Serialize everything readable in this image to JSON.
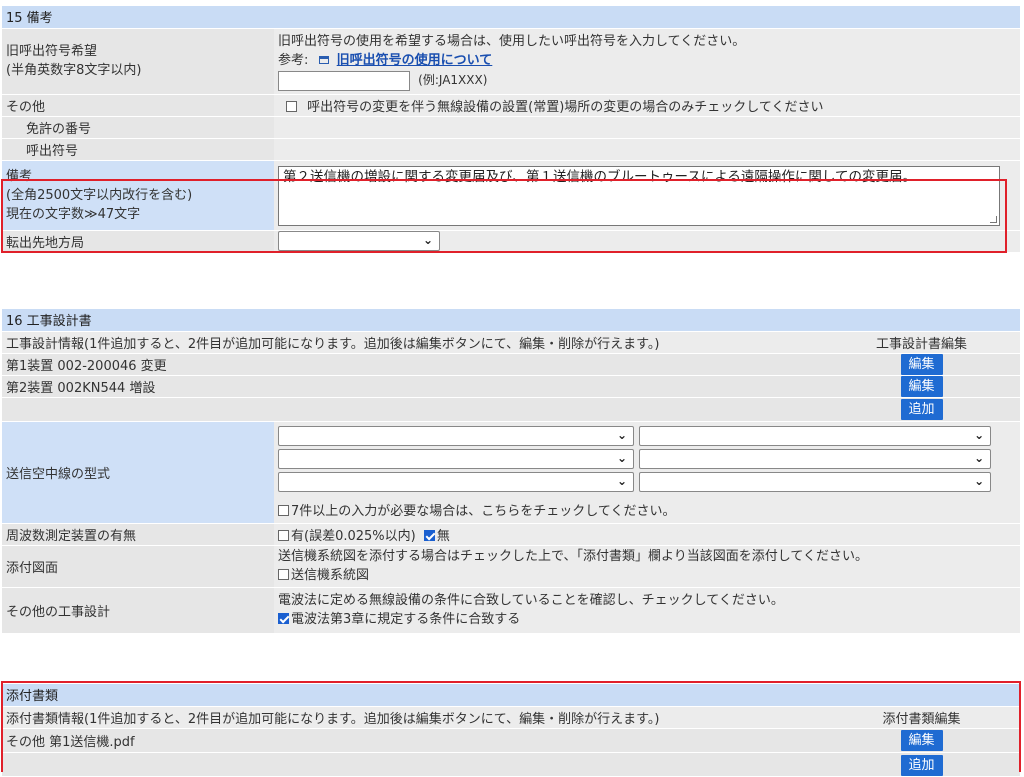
{
  "section15": {
    "header": "15 備考",
    "old_callsign": {
      "label_line1": "旧呼出符号希望",
      "label_line2": "(半角英数字8文字以内)",
      "instruction": "旧呼出符号の使用を希望する場合は、使用したい呼出符号を入力してください。",
      "ref_prefix": "参考:",
      "ref_link": "旧呼出符号の使用について",
      "input_value": "",
      "example": "(例:JA1XXX)"
    },
    "other": {
      "label": "その他",
      "checkbox_label": "呼出符号の変更を伴う無線設備の設置(常置)場所の変更の場合のみチェックしてください",
      "checked": false
    },
    "license_number_label": "免許の番号",
    "callsign_label": "呼出符号",
    "remarks": {
      "label_line1": "備考",
      "label_line2": "(全角2500文字以内改行を含む)",
      "label_line3": "現在の文字数≫47文字",
      "text": "第２送信機の増設に関する変更届及び、第１送信機のブルートゥースによる遠隔操作に関しての変更届。"
    },
    "transfer_bureau": {
      "label": "転出先地方局",
      "selected": ""
    }
  },
  "section16": {
    "header": "16 工事設計書",
    "info_text": "工事設計情報(1件追加すると、2件目が追加可能になります。追加後は編集ボタンにて、編集・削除が行えます。)",
    "edit_column_header": "工事設計書編集",
    "devices": [
      {
        "text": "第1装置 002-200046 変更",
        "button": "編集"
      },
      {
        "text": "第2装置 002KN544 増設",
        "button": "編集"
      }
    ],
    "add_button": "追加",
    "antenna": {
      "label": "送信空中線の型式",
      "checkbox_label": "7件以上の入力が必要な場合は、こちらをチェックしてください。",
      "checked": false
    },
    "freq_device": {
      "label": "周波数測定装置の有無",
      "option_yes": "有(誤差0.025%以内)",
      "yes_checked": false,
      "option_no": "無",
      "no_checked": true
    },
    "attached_drawing": {
      "label": "添付図面",
      "instruction": "送信機系統図を添付する場合はチェックした上で、「添付書類」欄より当該図面を添付してください。",
      "checkbox_label": "送信機系統図",
      "checked": false
    },
    "other_design": {
      "label": "その他の工事設計",
      "instruction": "電波法に定める無線設備の条件に合致していることを確認し、チェックしてください。",
      "checkbox_label": "電波法第3章に規定する条件に合致する",
      "checked": true
    }
  },
  "attachments": {
    "header": "添付書類",
    "info_text": "添付書類情報(1件追加すると、2件目が追加可能になります。追加後は編集ボタンにて、編集・削除が行えます。)",
    "edit_column_header": "添付書類編集",
    "files": [
      {
        "text": "その他 第1送信機.pdf",
        "button": "編集"
      }
    ],
    "add_button": "追加"
  },
  "colors": {
    "header_bg": "#c9dcf5",
    "button_bg": "#1f6bd2",
    "highlight_border": "#e0202a"
  }
}
